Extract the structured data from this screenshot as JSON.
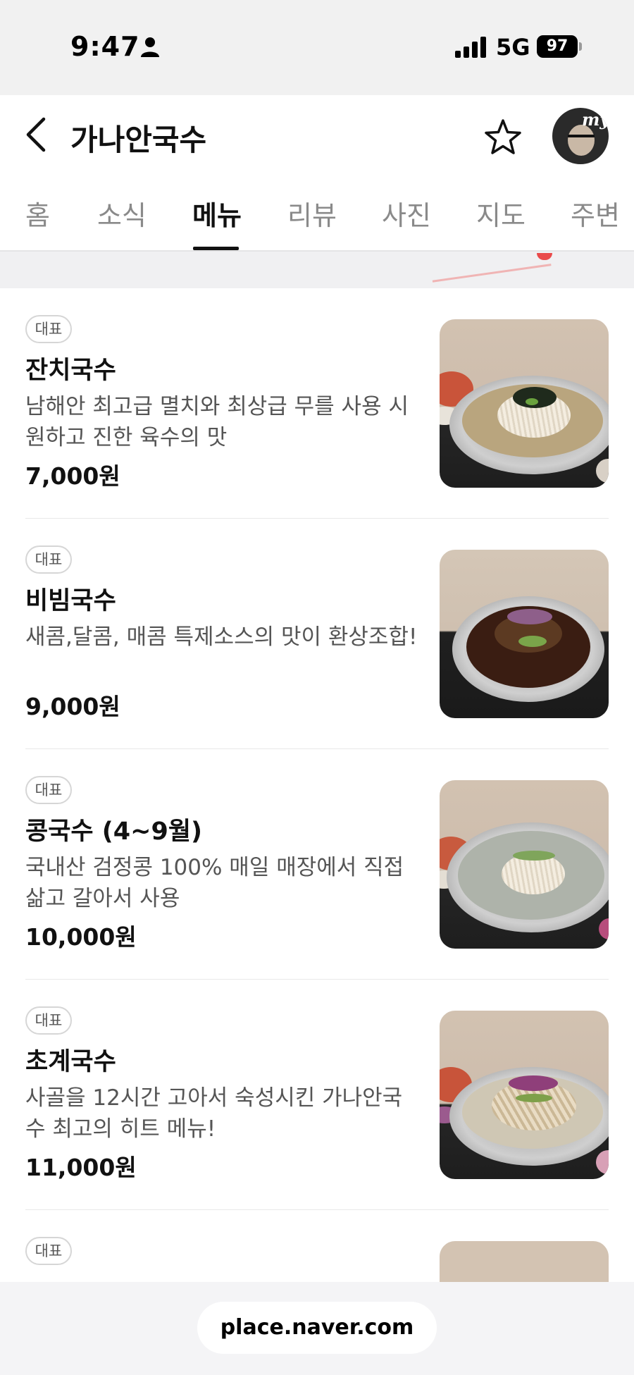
{
  "status_bar": {
    "time": "9:47",
    "network": "5G",
    "battery": "97"
  },
  "header": {
    "title": "가나안국수"
  },
  "tabs": [
    {
      "label": "홈"
    },
    {
      "label": "소식"
    },
    {
      "label": "메뉴",
      "active": true
    },
    {
      "label": "리뷰"
    },
    {
      "label": "사진"
    },
    {
      "label": "지도"
    },
    {
      "label": "주변"
    }
  ],
  "avatar": {
    "badge_text": "my"
  },
  "menu_items": [
    {
      "badge": "대표",
      "name": "잔치국수",
      "description": "남해안 최고급 멸치와 최상급 무를 사용 시원하고 진한 육수의 맛",
      "price": "7,000원",
      "image_icon": "janchi-guksu-photo"
    },
    {
      "badge": "대표",
      "name": "비빔국수",
      "description": "새콤,달콤, 매콤 특제소스의 맛이 환상조합!",
      "price": "9,000원",
      "image_icon": "bibim-guksu-photo"
    },
    {
      "badge": "대표",
      "name": "콩국수 (4~9월)",
      "description": "국내산 검정콩 100% 매일 매장에서 직접 삶고 갈아서 사용",
      "price": "10,000원",
      "image_icon": "kong-guksu-photo"
    },
    {
      "badge": "대표",
      "name": "초계국수",
      "description": "사골을 12시간 고아서 숙성시킨 가나안국수 최고의 히트 메뉴!",
      "price": "11,000원",
      "image_icon": "chogye-guksu-photo"
    },
    {
      "badge": "대표",
      "name": "",
      "description": "",
      "price": "",
      "image_icon": "menu-photo"
    }
  ],
  "url_bar": {
    "url": "place.naver.com"
  },
  "colors": {
    "accent": "#111111",
    "muted_text": "#8a8a8a",
    "divider": "#e8e8e8",
    "band": "#f0f0f2"
  }
}
